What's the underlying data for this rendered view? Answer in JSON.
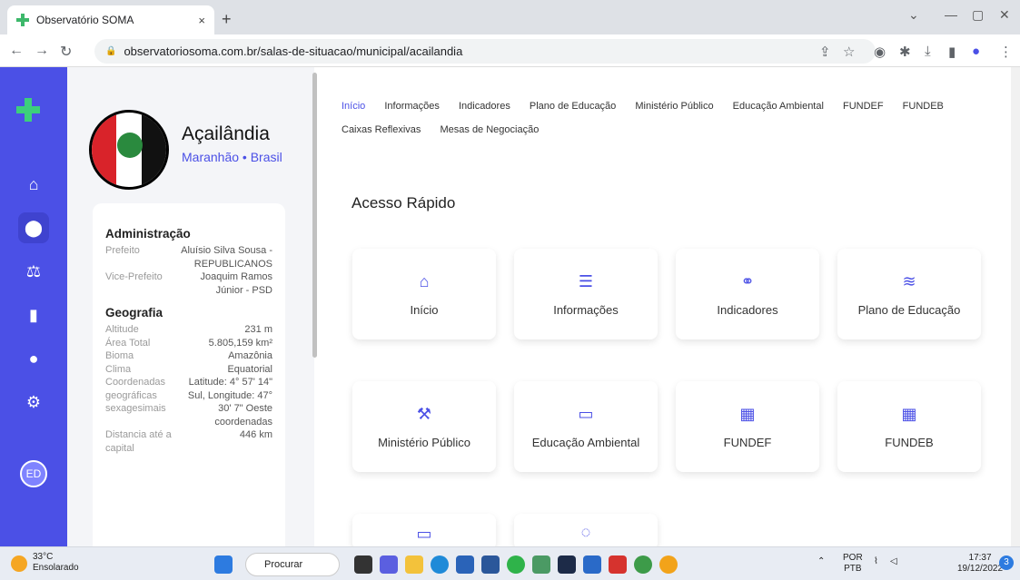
{
  "browser": {
    "tab_title": "Observatório SOMA",
    "tab_close": "×",
    "new_tab": "+",
    "url": "observatoriosoma.com.br/salas-de-situacao/municipal/acailandia"
  },
  "municipality": {
    "name": "Açailândia",
    "location": "Maranhão • Brasil"
  },
  "avatar_initials": "ED",
  "info": {
    "admin_title": "Administração",
    "admin_rows": [
      {
        "k": "Prefeito",
        "v": "Aluísio Silva Sousa - REPUBLICANOS"
      },
      {
        "k": "Vice-Prefeito",
        "v": "Joaquim Ramos Júnior - PSD"
      }
    ],
    "geo_title": "Geografia",
    "geo_rows": [
      {
        "k": "Altitude",
        "v": "231 m"
      },
      {
        "k": "Área Total",
        "v": "5.805,159 km²"
      },
      {
        "k": "Bioma",
        "v": "Amazônia"
      },
      {
        "k": "Clima",
        "v": "Equatorial"
      },
      {
        "k": "Coordenadas geográficas sexagesimais",
        "v": "Latitude: 4° 57' 14\" Sul, Longitude: 47° 30' 7\" Oeste coordenadas"
      },
      {
        "k": "Distancia até a capital",
        "v": "446 km"
      }
    ]
  },
  "nav": {
    "row1": [
      "Início",
      "Informações",
      "Indicadores",
      "Plano de Educação",
      "Ministério Público",
      "Educação Ambiental",
      "FUNDEF",
      "FUNDEB"
    ],
    "row2": [
      "Caixas Reflexivas",
      "Mesas de Negociação"
    ]
  },
  "quick_access": {
    "title": "Acesso Rápido",
    "tiles": [
      {
        "label": "Início",
        "icon": "home-icon"
      },
      {
        "label": "Informações",
        "icon": "lines-icon"
      },
      {
        "label": "Indicadores",
        "icon": "nodes-icon"
      },
      {
        "label": "Plano de Educação",
        "icon": "layers-icon"
      },
      {
        "label": "Ministério Público",
        "icon": "gavel-icon"
      },
      {
        "label": "Educação Ambiental",
        "icon": "chat-icon"
      },
      {
        "label": "FUNDEF",
        "icon": "grid-icon"
      },
      {
        "label": "FUNDEB",
        "icon": "grid-icon"
      }
    ]
  },
  "taskbar": {
    "temp": "33°C",
    "weather": "Ensolarado",
    "search": "Procurar",
    "lang1": "POR",
    "lang2": "PTB",
    "time": "17:37",
    "date": "19/12/2022",
    "notif_count": "3"
  }
}
